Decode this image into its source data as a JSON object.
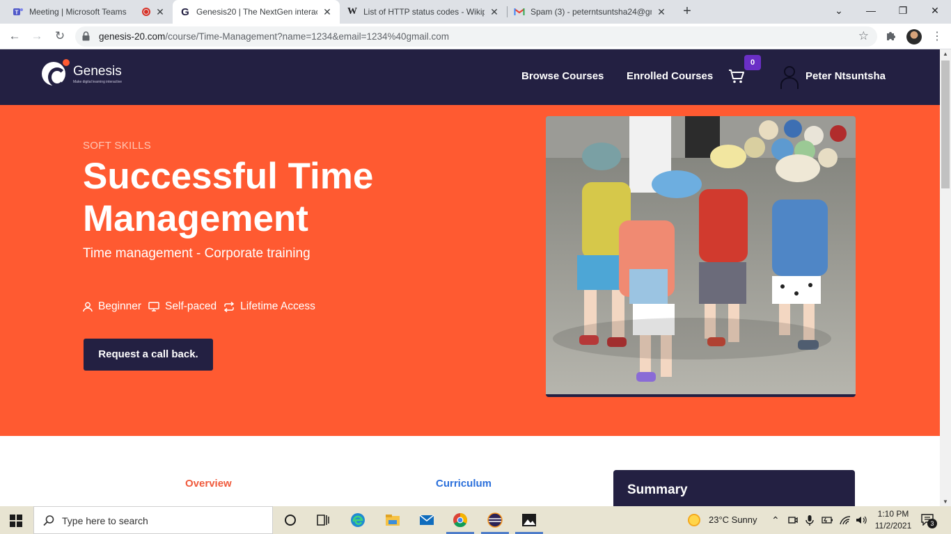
{
  "browser": {
    "tabs": [
      {
        "title": "Meeting | Microsoft Teams",
        "icon": "teams-icon",
        "recording": true
      },
      {
        "title": "Genesis20 | The NextGen interact",
        "icon": "genesis-icon",
        "active": true
      },
      {
        "title": "List of HTTP status codes - Wikip",
        "icon": "wikipedia-icon"
      },
      {
        "title": "Spam (3) - peterntsuntsha24@gm",
        "icon": "gmail-icon"
      }
    ],
    "url_host": "genesis-20.com",
    "url_path": "/course/Time-Management?name=1234&email=1234%40gmail.com"
  },
  "site": {
    "logo_name": "Genesis",
    "logo_tagline": "Make digital learning interactive",
    "nav": {
      "browse": "Browse Courses",
      "enrolled": "Enrolled Courses",
      "cart_count": "0",
      "user": "Peter Ntsuntsha"
    }
  },
  "course": {
    "category": "SOFT SKILLS",
    "title": "Successful Time Management",
    "subtitle": "Time management - Corporate training",
    "meta": [
      "Beginner",
      "Self-paced",
      "Lifetime Access"
    ],
    "cta": "Request a call back.",
    "tabs": [
      "Overview",
      "Curriculum"
    ],
    "summary_title": "Summary"
  },
  "colors": {
    "hero": "#ff5a31",
    "nav": "#232042",
    "tab_active": "#f05a3c",
    "tab_link": "#2a6fdb"
  },
  "taskbar": {
    "search_placeholder": "Type here to search",
    "weather": "23°C  Sunny",
    "time": "1:10 PM",
    "date": "11/2/2021",
    "notifications": "3"
  }
}
